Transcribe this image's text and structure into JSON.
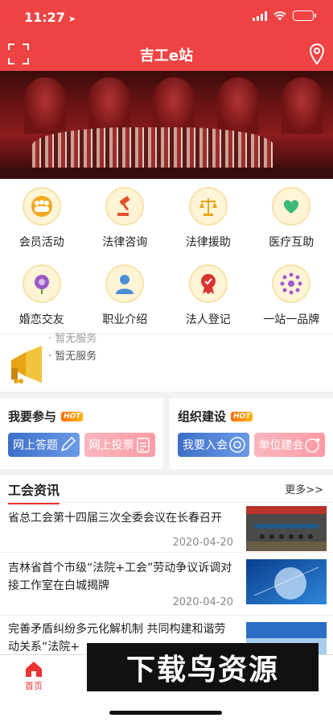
{
  "status": {
    "time": "11:27"
  },
  "header": {
    "title": "吉工e站"
  },
  "grid": {
    "items": [
      {
        "label": "会员活动",
        "icon": "members-icon"
      },
      {
        "label": "法律咨询",
        "icon": "gavel-icon"
      },
      {
        "label": "法律援助",
        "icon": "scales-icon"
      },
      {
        "label": "医疗互助",
        "icon": "heart-hands-icon"
      },
      {
        "label": "婚恋交友",
        "icon": "rose-icon"
      },
      {
        "label": "职业介绍",
        "icon": "person-icon"
      },
      {
        "label": "法人登记",
        "icon": "seal-icon"
      },
      {
        "label": "一站一品牌",
        "icon": "network-icon"
      }
    ]
  },
  "notice": {
    "line1": "· 暂无服务",
    "line2": "· 暂无服务"
  },
  "participate": {
    "title": "我要参与",
    "hot": "HOT",
    "btn1": "网上答题",
    "btn2": "网上投票"
  },
  "organize": {
    "title": "组织建设",
    "hot": "HOT",
    "btn1": "我要入会",
    "btn2": "单位建会"
  },
  "news": {
    "title": "工会资讯",
    "more": "更多>>",
    "items": [
      {
        "title": "省总工会第十四届三次全委会议在长春召开",
        "date": "2020-04-20"
      },
      {
        "title": "吉林省首个市级“法院+工会”劳动争议诉调对接工作室在白城揭牌",
        "date": "2020-04-20"
      },
      {
        "title": "完善矛盾纠纷多元化解机制 共同构建和谐劳动关系“法院+",
        "date": ""
      }
    ]
  },
  "tabbar": {
    "home": "首页"
  },
  "watermark": "下载鸟资源",
  "colors": {
    "brand": "#ef4343",
    "blue_btn": "#3d6fc8",
    "pink_btn": "#ff9aa3"
  }
}
